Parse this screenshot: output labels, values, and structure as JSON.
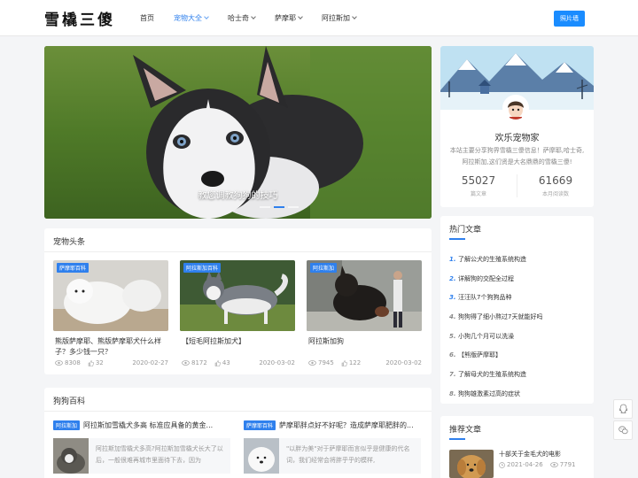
{
  "header": {
    "logo": "雪橇三傻",
    "nav": [
      {
        "label": "首页",
        "dropdown": false
      },
      {
        "label": "宠物大全",
        "dropdown": true,
        "active": true
      },
      {
        "label": "哈士奇",
        "dropdown": true
      },
      {
        "label": "萨摩耶",
        "dropdown": true
      },
      {
        "label": "阿拉斯加",
        "dropdown": true
      }
    ],
    "photo_button": "照片墙"
  },
  "hero": {
    "caption": "教您调教狗狗的技巧",
    "slides": 3,
    "active_slide": 2
  },
  "profile": {
    "name": "欢乐宠物家",
    "description": "本站主要分享狗界雪橇三傻信息！萨摩耶,哈士奇,阿拉斯加,这们贤是大名鼎鼎的雪橇三傻!",
    "stats": [
      {
        "value": "55027",
        "label": "篇文章"
      },
      {
        "value": "61669",
        "label": "本月阅读数"
      }
    ]
  },
  "pets": {
    "title": "宠物头条",
    "items": [
      {
        "tag": "萨摩耶百科",
        "title": "熊版萨摩耶、熊版萨摩耶犬什么样子？多少钱一只？",
        "views": "8308",
        "likes": "32",
        "date": "2020-02-27"
      },
      {
        "tag": "阿拉斯加百科",
        "title": "【短毛阿拉斯加犬】",
        "views": "8172",
        "likes": "43",
        "date": "2020-03-02"
      },
      {
        "tag": "阿拉斯加",
        "title": "阿拉斯加狗",
        "views": "7945",
        "likes": "122",
        "date": "2020-03-02"
      }
    ]
  },
  "encyclopedia": {
    "title": "狗狗百科",
    "items": [
      {
        "tag": "阿拉斯加",
        "title": "阿拉斯加雪橇犬多高 标准应具备的黄金...",
        "excerpt": "阿拉斯加雪橇犬多高?阿拉斯加雪橇犬长大了以后，一般很难再城市里面待下去，因为"
      },
      {
        "tag": "萨摩耶百科",
        "title": "萨摩耶胖点好不好呢？造成萨摩耶肥胖的...",
        "excerpt": "\"以胖为美\"对于萨摩耶而言似乎是健康的代名词，我们经常会将胖乎乎的模样,"
      }
    ]
  },
  "hot": {
    "title": "热门文章",
    "items": [
      {
        "num": "1.",
        "title": "了解公犬的生殖系统构造"
      },
      {
        "num": "2.",
        "title": "详解狗的交配全过程"
      },
      {
        "num": "3.",
        "title": "汪汪队7个狗狗品种"
      },
      {
        "num": "4.",
        "title": "狗狗得了细小熬过7天就能好吗"
      },
      {
        "num": "5.",
        "title": "小狗几个月可以洗澡"
      },
      {
        "num": "6.",
        "title": "【熊版萨摩耶】"
      },
      {
        "num": "7.",
        "title": "了解母犬的生殖系统构造"
      },
      {
        "num": "8.",
        "title": "狗狗雄激素过高的症状"
      }
    ]
  },
  "recommend": {
    "title": "推荐文章",
    "item": {
      "title": "十部关于金毛犬的电影",
      "date": "2021-04-26",
      "views": "7791"
    }
  },
  "colors": {
    "accent": "#2f80ed",
    "button": "#1a8cff",
    "background": "#f4f5f7"
  },
  "icons": [
    "eye-icon",
    "thumb-up-icon",
    "clock-icon",
    "qq-icon",
    "wechat-icon",
    "chevron-down-icon"
  ]
}
